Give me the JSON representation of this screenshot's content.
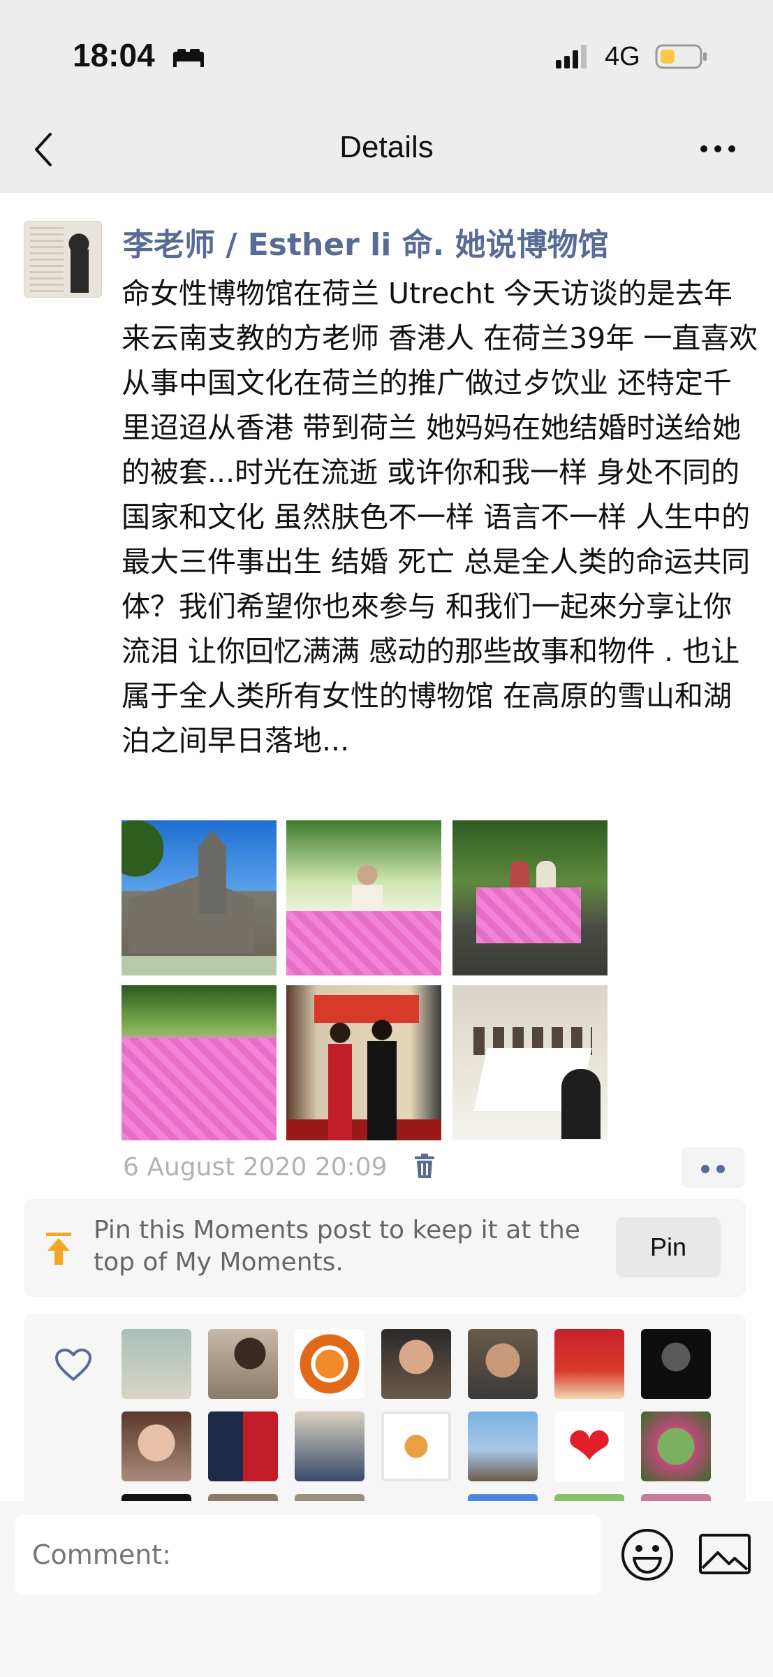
{
  "status_bar": {
    "time": "18:04",
    "network": "4G"
  },
  "nav": {
    "title": "Details"
  },
  "post": {
    "author": "李老师 / Esther li 命. 她说博物馆",
    "text": "命女性博物馆在荷兰 Utrecht 今天访谈的是去年来云南支教的方老师  香港人 在荷兰39年  一直喜欢从事中国文化在荷兰的推广做过歺饮业 还特定千里迢迢从香港 带到荷兰 她妈妈在她结婚时送给她的被套...时光在流逝 或许你和我一样  身处不同的国家和文化  虽然肤色不一样 语言不一样 人生中的最大三件事出生 结婚 死亡 总是全人类的命运共同体？我们希望你也來参与 和我们一起來分享让你流泪 让你回忆满满 感动的那些故事和物件 . 也让属于全人类所有女性的博物馆 在高原的雪山和湖泊之间早日落地...",
    "timestamp": "6 August 2020 20:09"
  },
  "pin": {
    "text": "Pin this Moments post to keep it at the top of My Moments.",
    "button_label": "Pin"
  },
  "comment": {
    "placeholder": "Comment:"
  },
  "colors": {
    "link": "#576b95",
    "bar_bg": "#ededed",
    "card_bg": "#f6f6f6"
  }
}
